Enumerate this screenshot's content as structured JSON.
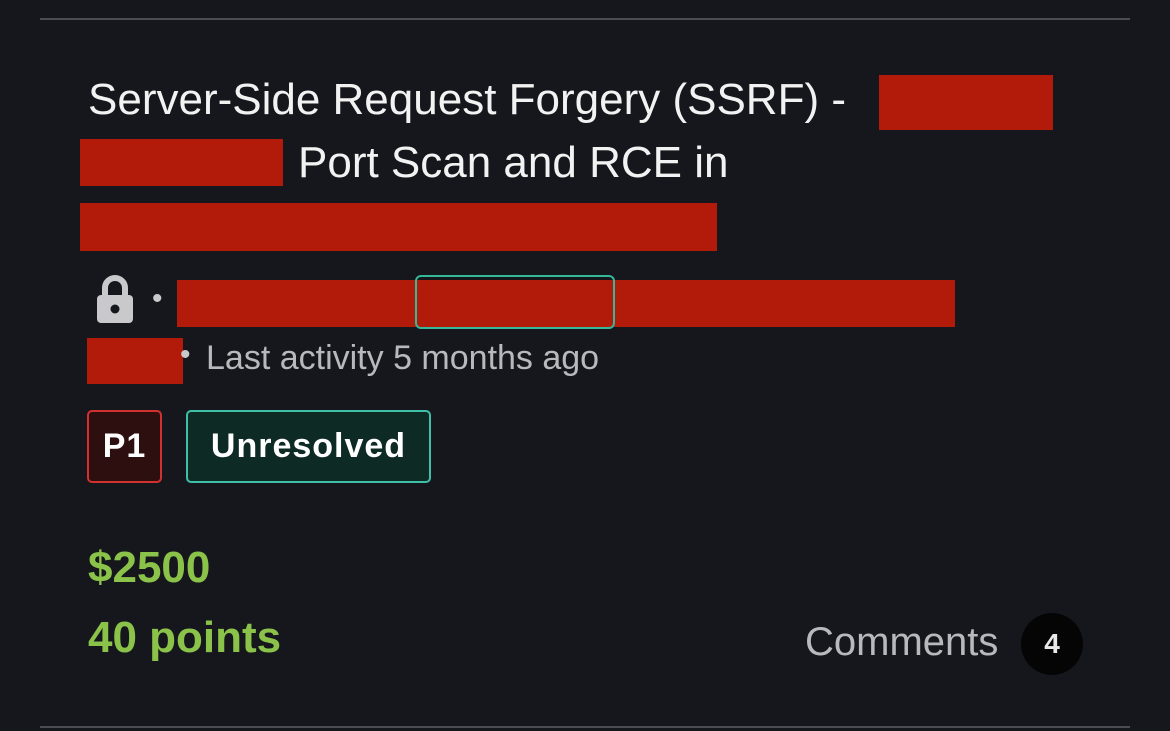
{
  "report": {
    "title_part1": "Server-Side Request Forgery (SSRF) -",
    "title_part2": "Port Scan and RCE in",
    "meta_separator": "•",
    "last_activity": "Last activity 5 months ago",
    "severity": "P1",
    "status": "Unresolved",
    "bounty": "$2500",
    "points": "40 points",
    "comments_label": "Comments",
    "comments_count": "4"
  },
  "icons": {
    "visibility": "lock-icon"
  },
  "colors": {
    "background": "#16171c",
    "redaction": "#b21a0a",
    "bounty_green": "#8bc34a",
    "severity_red": "#d1312f",
    "status_teal": "#3fc0a6"
  }
}
